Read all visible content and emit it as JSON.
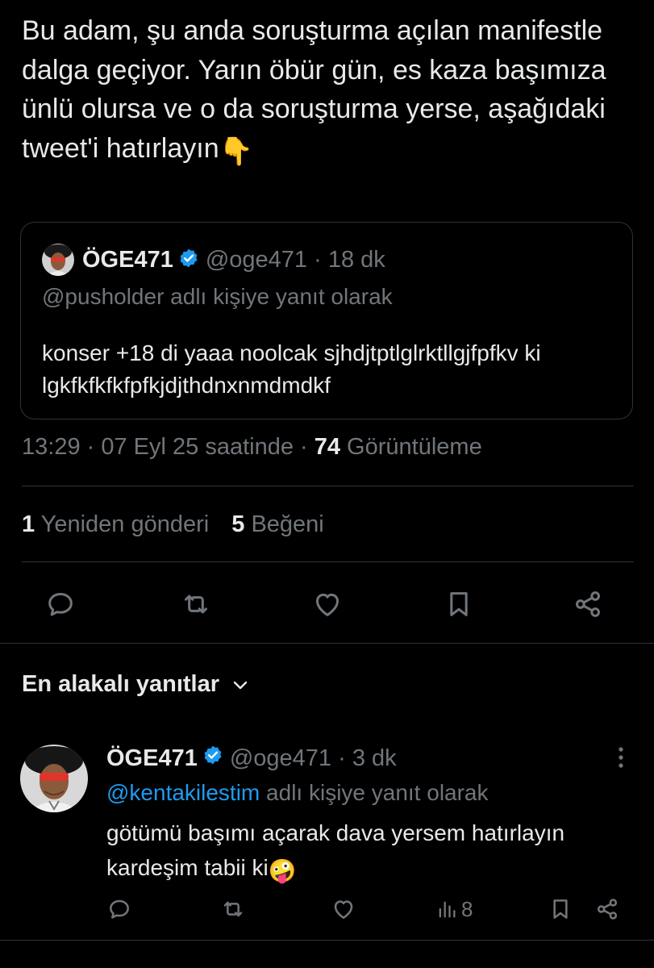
{
  "tweet": {
    "text": "Bu adam, şu anda soruşturma açılan manifestle dalga geçiyor. Yarın öbür gün, es kaza başımıza ünlü olursa ve o da soruşturma yerse, aşağıdaki tweet'i hatırlayın",
    "emoji": "👇",
    "time": "13:29 · 07 Eyl 25 saatinde · ",
    "views_count": "74",
    "views_label": " Görüntüleme",
    "reposts_count": "1",
    "reposts_label": " Yeniden gönderi",
    "likes_count": "5",
    "likes_label": " Beğeni"
  },
  "quote": {
    "name": "ÖGE471",
    "handle": "@oge471 · 18 dk",
    "reply_to": "@pusholder adlı kişiye yanıt olarak",
    "text": "konser +18 di yaaa noolcak sjhdjtptlglrktllgjfpfkv ki lgkfkfkfkfpfkjdjthdnxnmdmdkf"
  },
  "replies": {
    "header": "En alakalı yanıtlar"
  },
  "reply": {
    "name": "ÖGE471",
    "handle": "@oge471 · 3 dk",
    "mention": "@kentakilestim",
    "reply_suffix": " adlı kişiye yanıt olarak",
    "text": "götümü başımı açarak dava yersem hatırlayın kardeşim tabii ki",
    "emoji": "🤪",
    "views": "8"
  },
  "icons": {
    "verified": "verified-badge-icon",
    "reply": "reply-icon",
    "repost": "repost-icon",
    "like": "heart-icon",
    "bookmark": "bookmark-icon",
    "share": "share-icon",
    "views": "views-icon",
    "more": "more-icon",
    "chevron": "chevron-down-icon"
  },
  "colors": {
    "background": "#000000",
    "text": "#e7e9ea",
    "muted": "#71767b",
    "accent": "#1d9bf0",
    "border": "#2f3336"
  }
}
